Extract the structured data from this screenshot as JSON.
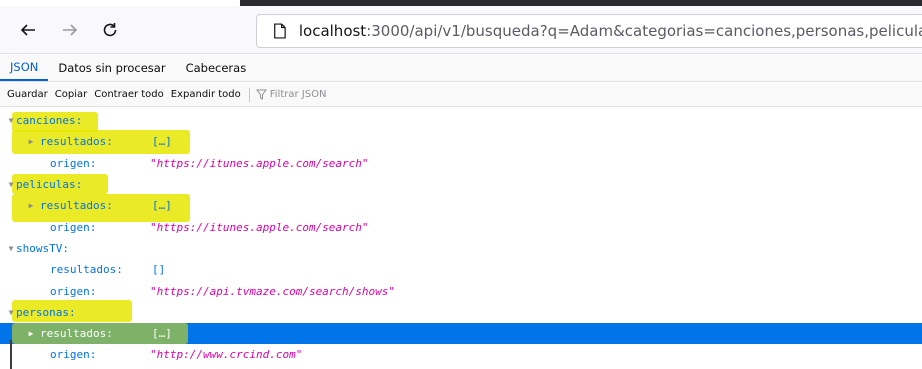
{
  "browser": {
    "url_host": "localhost",
    "url_rest": ":3000/api/v1/busqueda?q=Adam&categorias=canciones,personas,peliculas",
    "back_icon": "arrow-left-icon",
    "forward_icon": "arrow-right-icon",
    "reload_icon": "reload-icon",
    "page_icon": "page-icon"
  },
  "viewer_tabs": [
    {
      "label": "JSON",
      "active": true
    },
    {
      "label": "Datos sin procesar",
      "active": false
    },
    {
      "label": "Cabeceras",
      "active": false
    }
  ],
  "toolbar": {
    "save": "Guardar",
    "copy": "Copiar",
    "collapse": "Contraer todo",
    "expand": "Expandir todo",
    "filter_placeholder": "Filtrar JSON",
    "filter_icon": "filter-icon"
  },
  "tree": {
    "canciones": {
      "key": "canciones:",
      "resultados_key": "resultados:",
      "resultados_val": "[…]",
      "origen_key": "origen:",
      "origen_val": "\"https://itunes.apple.com/search\""
    },
    "peliculas": {
      "key": "peliculas:",
      "resultados_key": "resultados:",
      "resultados_val": "[…]",
      "origen_key": "origen:",
      "origen_val": "\"https://itunes.apple.com/search\""
    },
    "showsTV": {
      "key": "showsTV:",
      "resultados_key": "resultados:",
      "resultados_val": "[]",
      "origen_key": "origen:",
      "origen_val": "\"https://api.tvmaze.com/search/shows\""
    },
    "personas": {
      "key": "personas:",
      "resultados_key": "resultados:",
      "resultados_val": "[…]",
      "origen_key": "origen:",
      "origen_val": "\"http://www.crcind.com\""
    }
  },
  "colors": {
    "key": "#0074e8",
    "string": "#dd00a9",
    "selected_row": "#0074e8",
    "highlighter": "#e6e600"
  }
}
